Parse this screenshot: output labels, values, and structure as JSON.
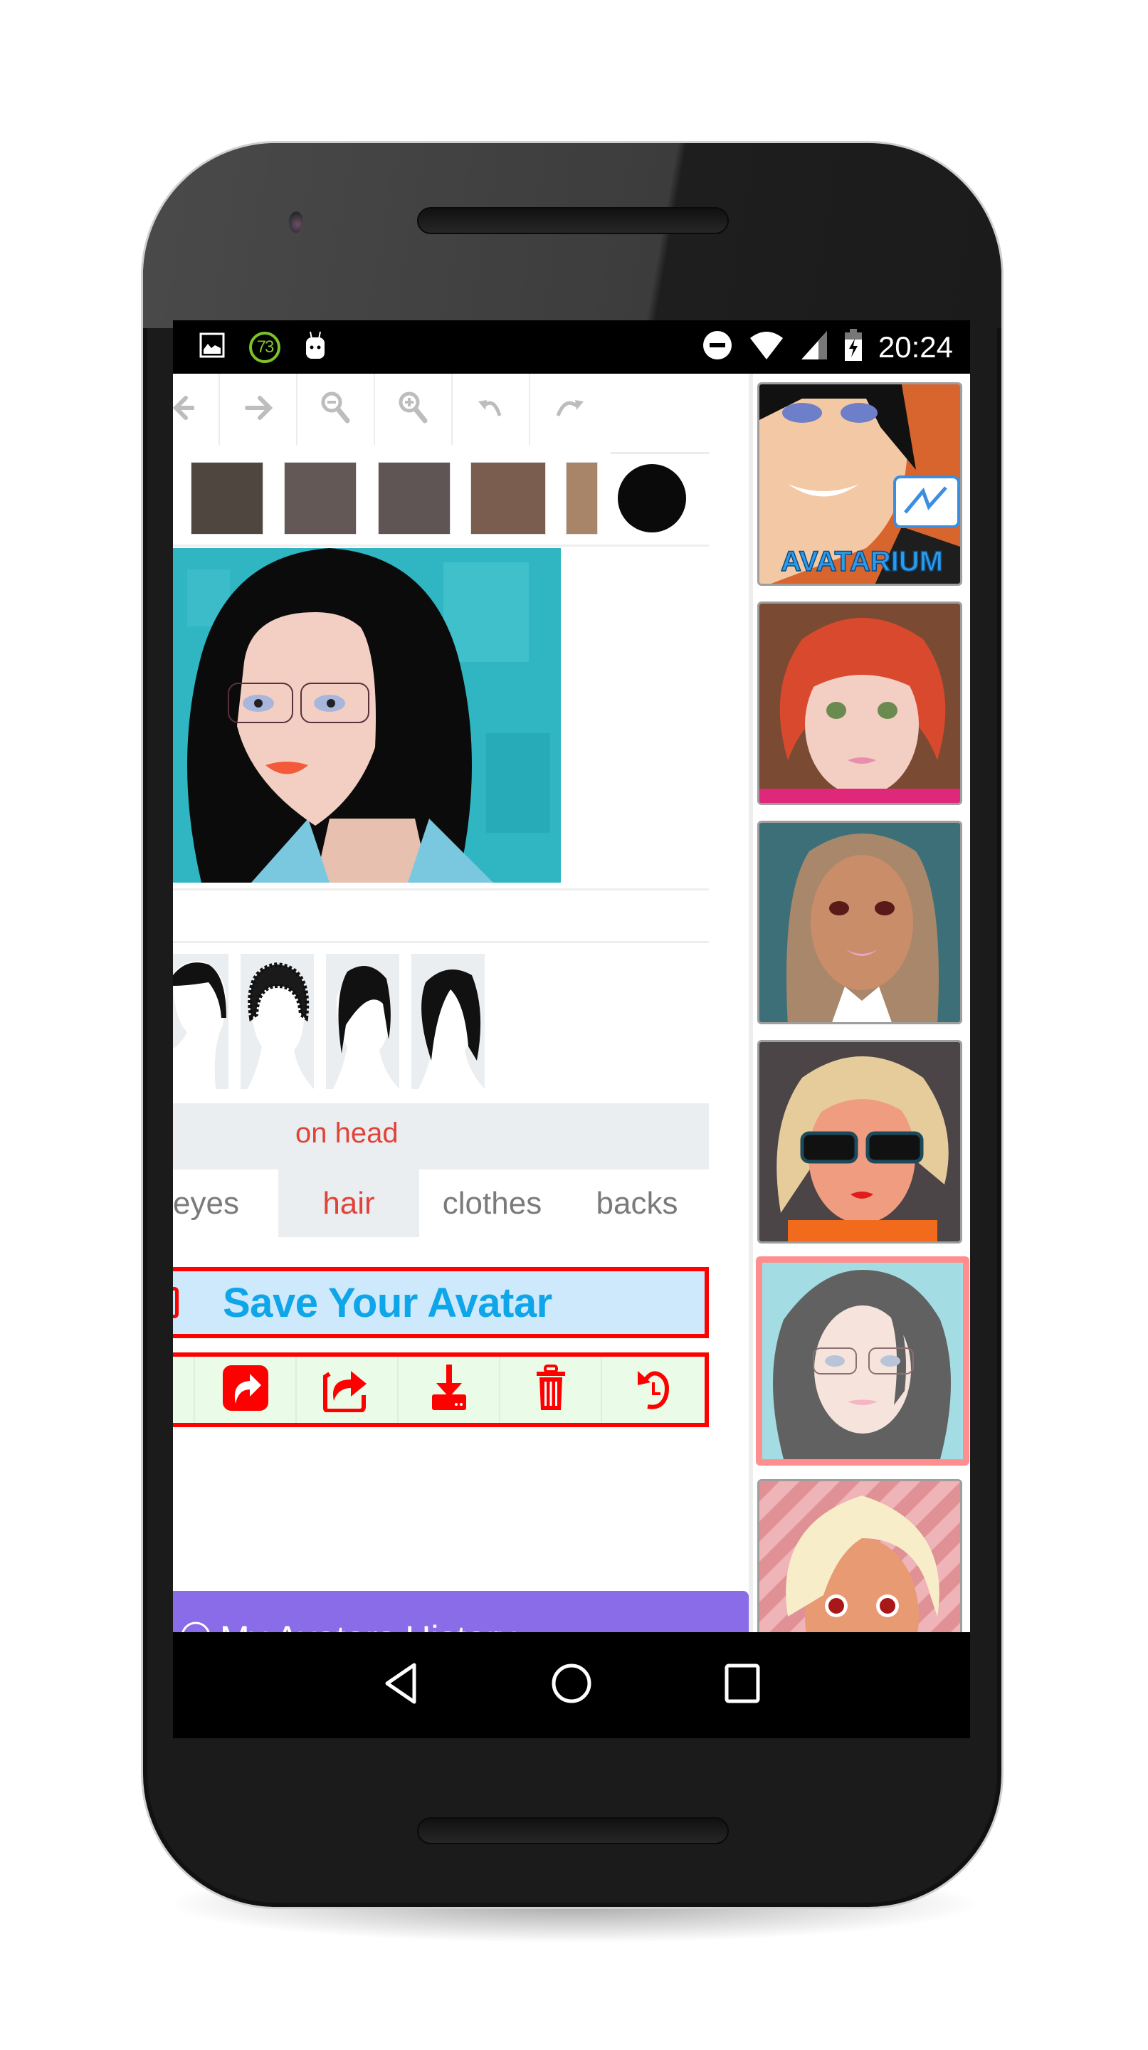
{
  "status_bar": {
    "left_icons": [
      "image-notification-icon",
      "counter-badge-icon",
      "android-bot-icon"
    ],
    "badge_value": "73",
    "right_icons": [
      "do-not-disturb-icon",
      "wifi-icon",
      "cell-signal-icon",
      "battery-charging-icon"
    ],
    "time": "20:24"
  },
  "toolbar": {
    "tools": [
      {
        "name": "back-arrow-icon",
        "glyph": "←"
      },
      {
        "name": "forward-arrow-icon",
        "glyph": "→"
      },
      {
        "name": "zoom-out-icon",
        "glyph": "−"
      },
      {
        "name": "zoom-in-icon",
        "glyph": "+"
      },
      {
        "name": "undo-icon",
        "glyph": "↶"
      },
      {
        "name": "redo-icon",
        "glyph": "↷"
      }
    ]
  },
  "swatches": {
    "colors": [
      "#4f473f",
      "#635856",
      "#5f5554",
      "#7a5d4f",
      "#a88568"
    ],
    "selected_color": "#0a0a0a"
  },
  "editor": {
    "subcategory": "on head",
    "categories": [
      {
        "label": "eyes",
        "active": false
      },
      {
        "label": "hair",
        "active": true
      },
      {
        "label": "clothes",
        "active": false
      },
      {
        "label": "backs",
        "active": false
      }
    ],
    "hair_options": [
      "short-side-part",
      "curly-afro",
      "swept-bangs",
      "straight-bob"
    ]
  },
  "save": {
    "label": "Save Your Avatar"
  },
  "actions": [
    {
      "name": "share-square-icon"
    },
    {
      "name": "share-external-icon"
    },
    {
      "name": "download-icon"
    },
    {
      "name": "delete-icon"
    },
    {
      "name": "history-reset-icon"
    }
  ],
  "history": {
    "label": "My Avatars History",
    "icon": "☺"
  },
  "sidebar": {
    "thumbnails": [
      {
        "name": "avatarium-promo",
        "caption": "AVATARIUM",
        "selected": false
      },
      {
        "name": "red-hair-avatar",
        "selected": false
      },
      {
        "name": "brown-hair-avatar",
        "selected": false
      },
      {
        "name": "blonde-sunglasses-avatar",
        "selected": false
      },
      {
        "name": "current-avatar",
        "selected": true
      },
      {
        "name": "platinum-hair-avatar",
        "selected": false
      }
    ]
  },
  "colors": {
    "accent_red": "#ff0000",
    "tab_active": "#e0433a",
    "save_text": "#0ea5e9",
    "save_bg": "#cde9fb",
    "actions_bg": "#eafbe8",
    "history_bg": "#8a6be8"
  },
  "navbar": {
    "buttons": [
      "back-nav-icon",
      "home-nav-icon",
      "recents-nav-icon"
    ]
  }
}
